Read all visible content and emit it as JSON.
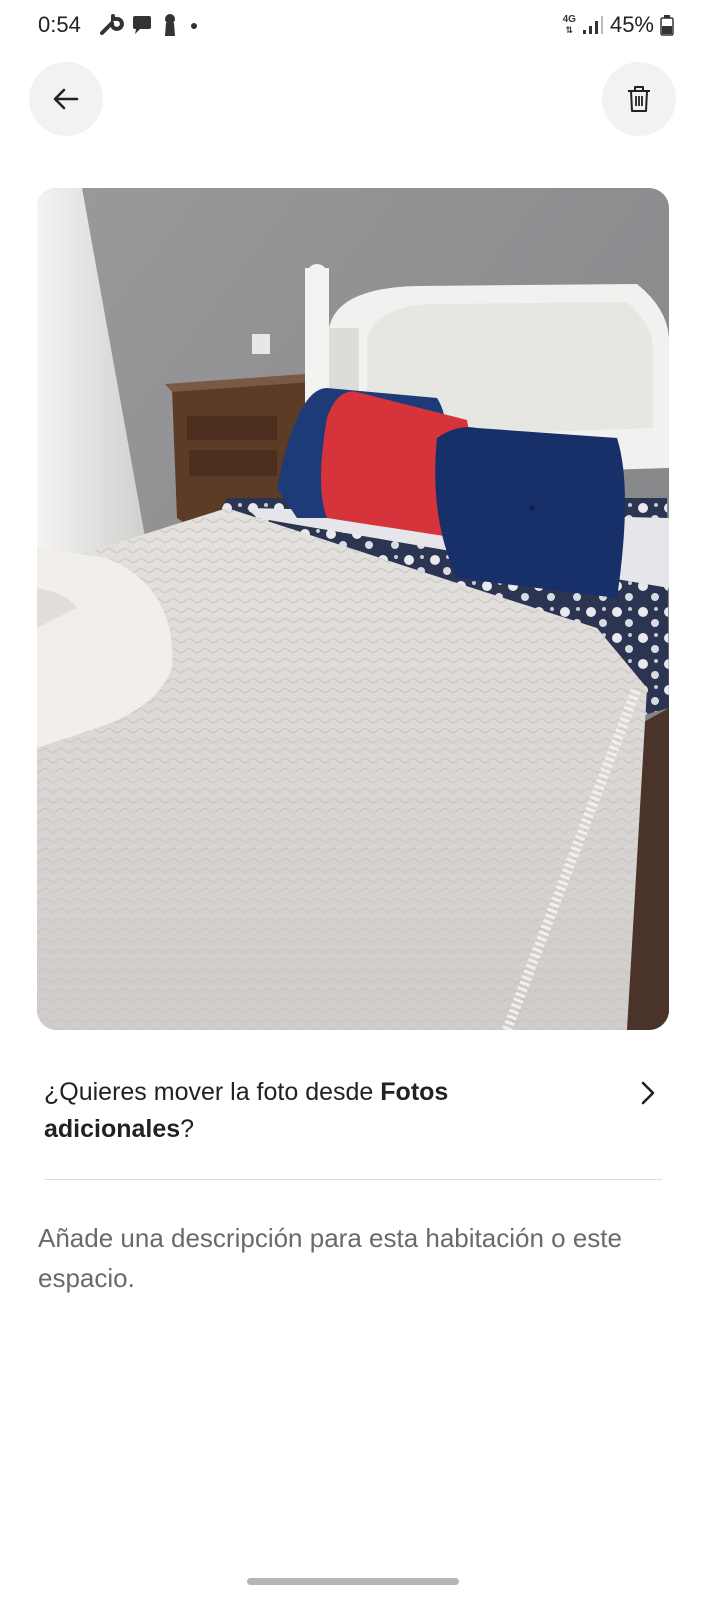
{
  "status_bar": {
    "time": "0:54",
    "network_type": "4G",
    "battery_percent": "45%"
  },
  "toolbar": {
    "back_icon": "arrow-left-icon",
    "delete_icon": "trash-icon"
  },
  "photo": {
    "subject": "bedroom"
  },
  "move_photo": {
    "prefix": "¿Quieres mover la foto desde ",
    "section_name": "Fotos adicionales",
    "suffix": "?"
  },
  "description": {
    "placeholder": "Añade una descripción para esta habitación o este espacio."
  },
  "colors": {
    "background": "#ffffff",
    "button_bg": "#f2f2f2",
    "text_primary": "#222222",
    "text_secondary": "#6a6a6a",
    "divider": "#dddddd"
  }
}
